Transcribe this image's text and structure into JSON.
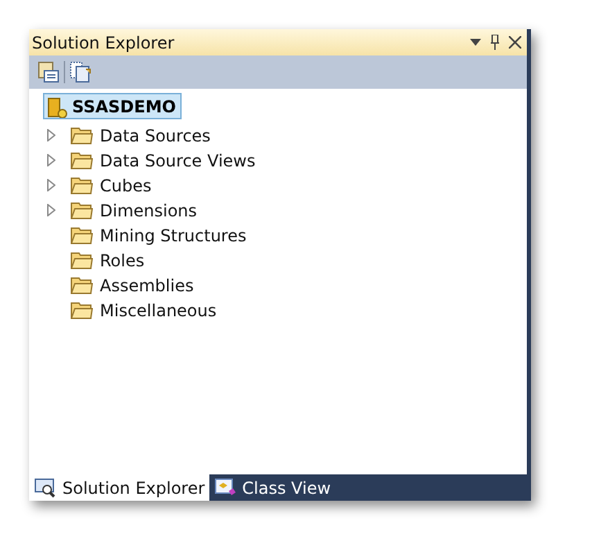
{
  "window": {
    "title": "Solution Explorer"
  },
  "tree": {
    "label": "SSASDEMO",
    "selected": true,
    "children": [
      {
        "label": "Data Sources",
        "expandable": true
      },
      {
        "label": "Data Source Views",
        "expandable": true
      },
      {
        "label": "Cubes",
        "expandable": true
      },
      {
        "label": "Dimensions",
        "expandable": true
      },
      {
        "label": "Mining Structures"
      },
      {
        "label": "Roles"
      },
      {
        "label": "Assemblies"
      },
      {
        "label": "Miscellaneous"
      }
    ]
  },
  "tabs": [
    {
      "label": "Solution Explorer",
      "selected": true
    },
    {
      "label": "Class View",
      "selected": false
    }
  ]
}
